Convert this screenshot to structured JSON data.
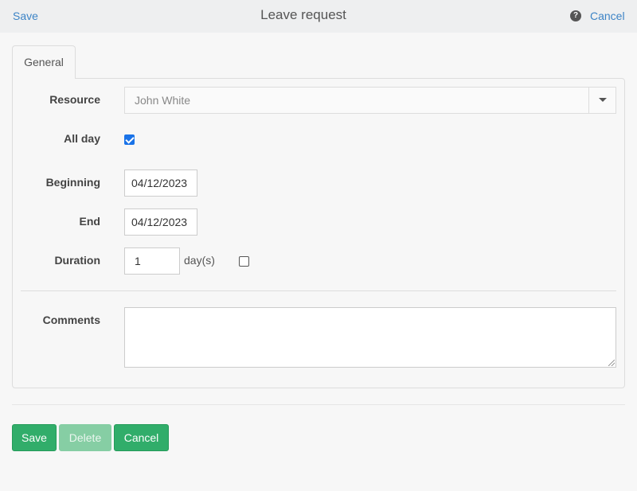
{
  "header": {
    "save_label": "Save",
    "title": "Leave request",
    "help_icon": "?",
    "cancel_label": "Cancel"
  },
  "tabs": [
    {
      "label": "General",
      "active": true
    }
  ],
  "form": {
    "resource": {
      "label": "Resource",
      "value": "John White"
    },
    "all_day": {
      "label": "All day",
      "checked": true
    },
    "beginning": {
      "label": "Beginning",
      "value": "04/12/2023"
    },
    "end": {
      "label": "End",
      "value": "04/12/2023"
    },
    "duration": {
      "label": "Duration",
      "value": "1",
      "unit": "day(s)",
      "half_day_checked": false
    },
    "comments": {
      "label": "Comments",
      "value": ""
    }
  },
  "footer": {
    "save_label": "Save",
    "delete_label": "Delete",
    "cancel_label": "Cancel"
  },
  "colors": {
    "link": "#3d84c6",
    "button_green": "#31ad6a",
    "button_disabled": "#86cea4",
    "checkbox_checked": "#1a73e8"
  }
}
